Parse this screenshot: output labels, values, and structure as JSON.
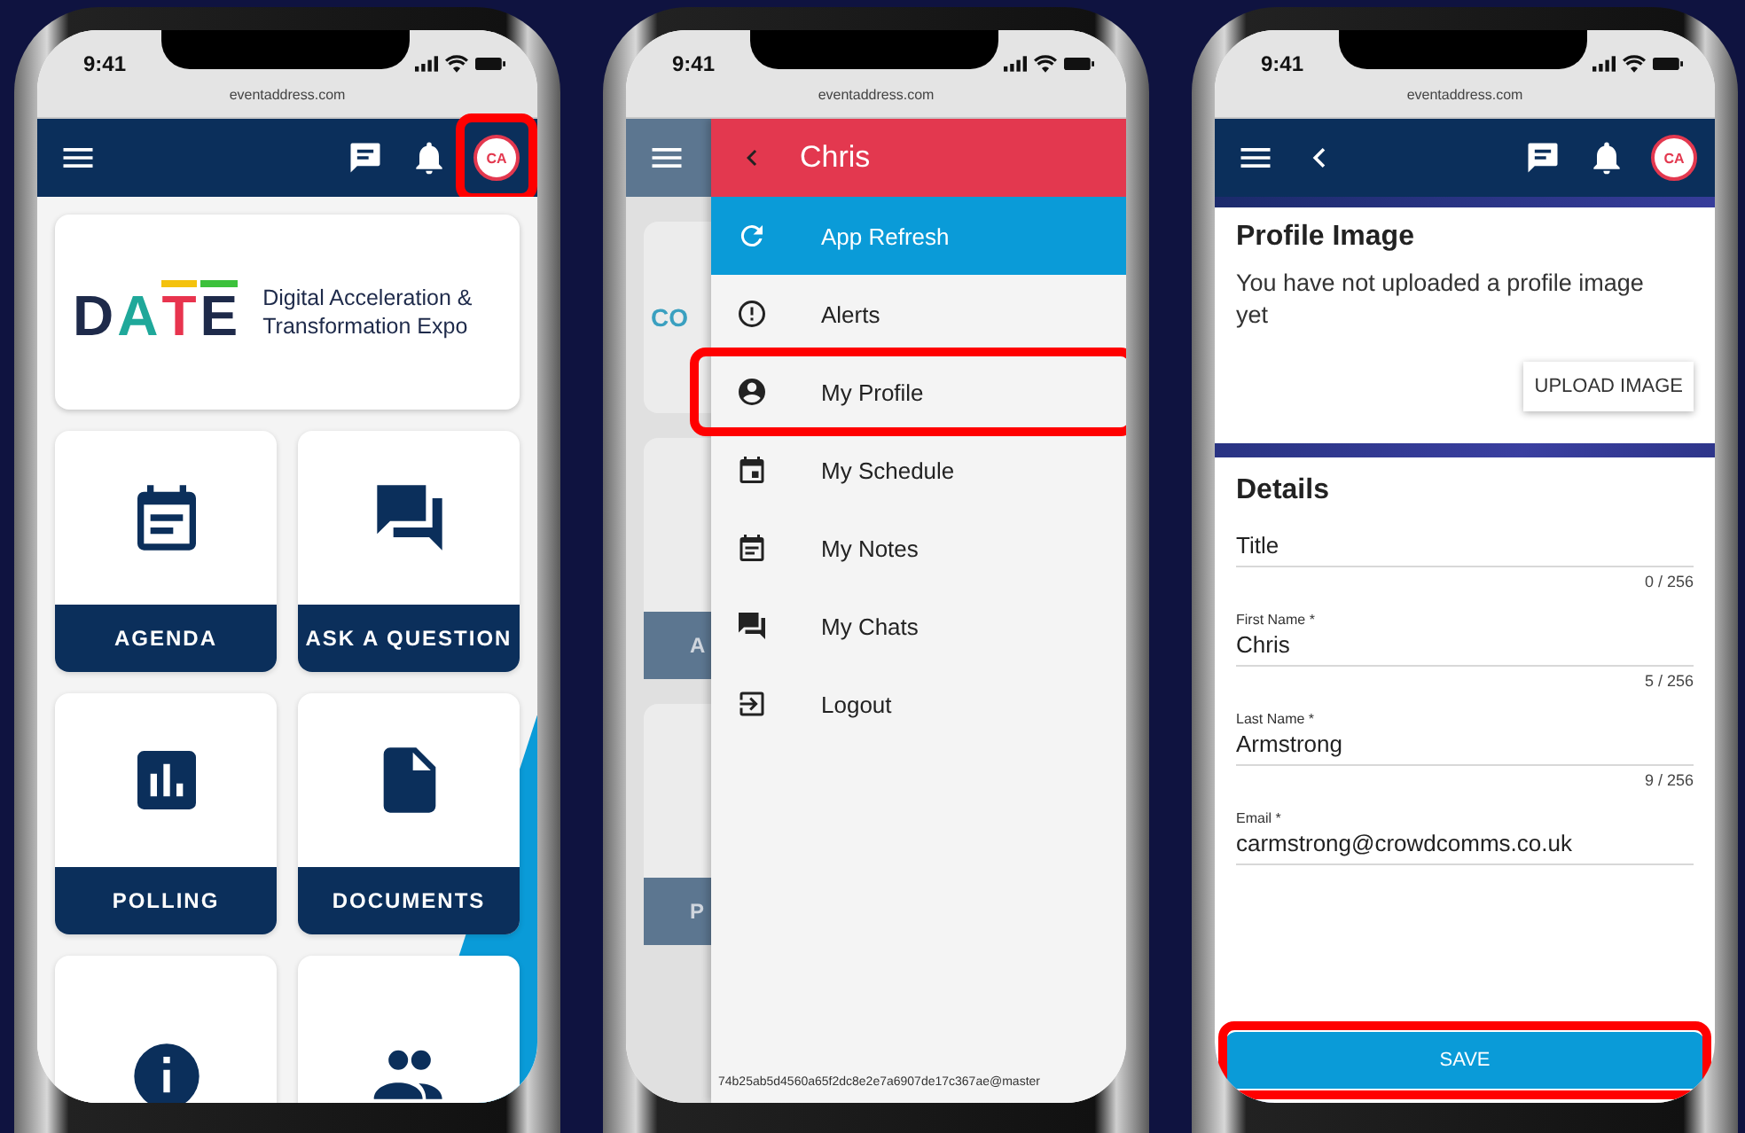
{
  "screens": [
    {
      "kind": "home",
      "status_time": "9:41",
      "url": "eventaddress.com",
      "avatar": "CA",
      "avatar_highlighted": true,
      "logo": {
        "wordmark": "DATE",
        "tagline": "Digital Acceleration & Transformation Expo"
      },
      "tiles": [
        {
          "kind": "labeled",
          "label": "AGENDA"
        },
        {
          "kind": "labeled",
          "label": "ASK A QUESTION"
        },
        {
          "kind": "labeled",
          "label": "POLLING"
        },
        {
          "kind": "labeled",
          "label": "DOCUMENTS"
        },
        {
          "kind": "cut"
        },
        {
          "kind": "cut"
        }
      ]
    },
    {
      "kind": "menu",
      "status_time": "9:41",
      "url": "eventaddress.com",
      "backdrop": {
        "logo_text": "CO",
        "tile_labels": [
          "A",
          "P"
        ]
      },
      "drawer": {
        "title": "Chris",
        "items": [
          {
            "label": "App Refresh",
            "selected": true,
            "highlighted": false
          },
          {
            "label": "Alerts",
            "selected": false,
            "highlighted": false
          },
          {
            "label": "My Profile",
            "selected": false,
            "highlighted": true
          },
          {
            "label": "My Schedule",
            "selected": false,
            "highlighted": false
          },
          {
            "label": "My Notes",
            "selected": false,
            "highlighted": false
          },
          {
            "label": "My Chats",
            "selected": false,
            "highlighted": false
          },
          {
            "label": "Logout",
            "selected": false,
            "highlighted": false
          }
        ],
        "footer": "74b25ab5d4560a65f2dc8e2e7a6907de17c367ae@master"
      }
    },
    {
      "kind": "profile",
      "status_time": "9:41",
      "url": "eventaddress.com",
      "avatar": "CA",
      "avatar_highlighted": false,
      "profile_image": {
        "title": "Profile Image",
        "message": "You have not uploaded a profile image yet",
        "button": "UPLOAD IMAGE"
      },
      "details": {
        "title": "Details",
        "fields": [
          {
            "placeholder": "Title",
            "counter": "0 / 256"
          },
          {
            "label": "First Name *",
            "value": "Chris",
            "counter": "5 / 256"
          },
          {
            "label": "Last Name *",
            "value": "Armstrong",
            "counter": "9 / 256"
          },
          {
            "label": "Email *",
            "value": "carmstrong@crowdcomms.co.uk"
          }
        ]
      },
      "save": {
        "label": "SAVE",
        "highlighted": true
      }
    }
  ]
}
